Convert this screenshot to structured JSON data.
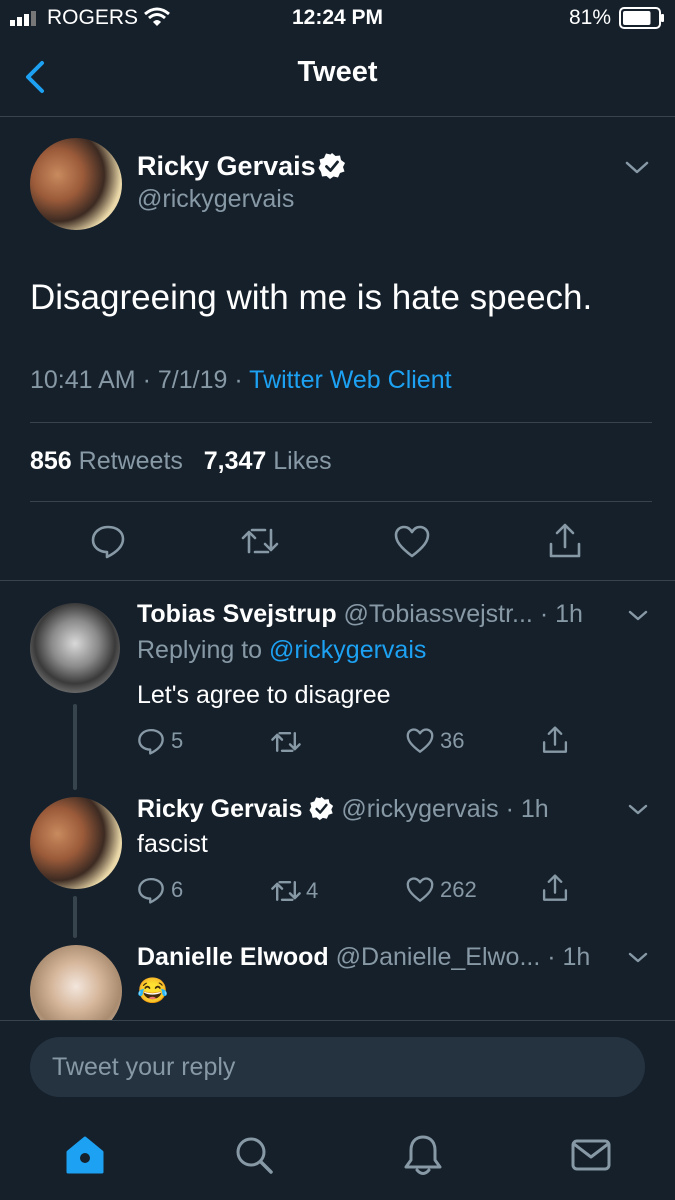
{
  "status_bar": {
    "carrier": "ROGERS",
    "time": "12:24 PM",
    "battery": "81%",
    "battery_level": 0.81
  },
  "nav": {
    "title": "Tweet"
  },
  "tweet": {
    "author_name": "Ricky Gervais",
    "author_handle": "@rickygervais",
    "text": "Disagreeing with me is hate speech.",
    "time": "10:41 AM",
    "date": "7/1/19",
    "separator": "·",
    "client": "Twitter Web Client",
    "retweet_count": "856",
    "retweet_label": "Retweets",
    "like_count": "7,347",
    "like_label": "Likes"
  },
  "replies": [
    {
      "name": "Tobias Svejstrup",
      "handle": "@Tobiassvejstr...",
      "time": "· 1h",
      "replying_prefix": "Replying to",
      "replying_to": "@rickygervais",
      "text": "Let's agree to disagree",
      "reply_count": "5",
      "retweet_count": "",
      "like_count": "36"
    },
    {
      "name": "Ricky Gervais",
      "handle": "@rickygervais",
      "time": "· 1h",
      "text": "fascist",
      "reply_count": "6",
      "retweet_count": "4",
      "like_count": "262"
    },
    {
      "name": "Danielle Elwood",
      "handle": "@Danielle_Elwo...",
      "time": "· 1h",
      "text": "😂"
    }
  ],
  "compose": {
    "placeholder": "Tweet your reply"
  },
  "tab_bar": {
    "items": [
      "home-icon",
      "search-icon",
      "notifications-icon",
      "messages-icon"
    ],
    "active": "home-icon"
  },
  "colors": {
    "background": "#15202b",
    "accent": "#1da1f2",
    "muted": "#8899a6",
    "divider": "#38444d",
    "input_bg": "#253341"
  }
}
